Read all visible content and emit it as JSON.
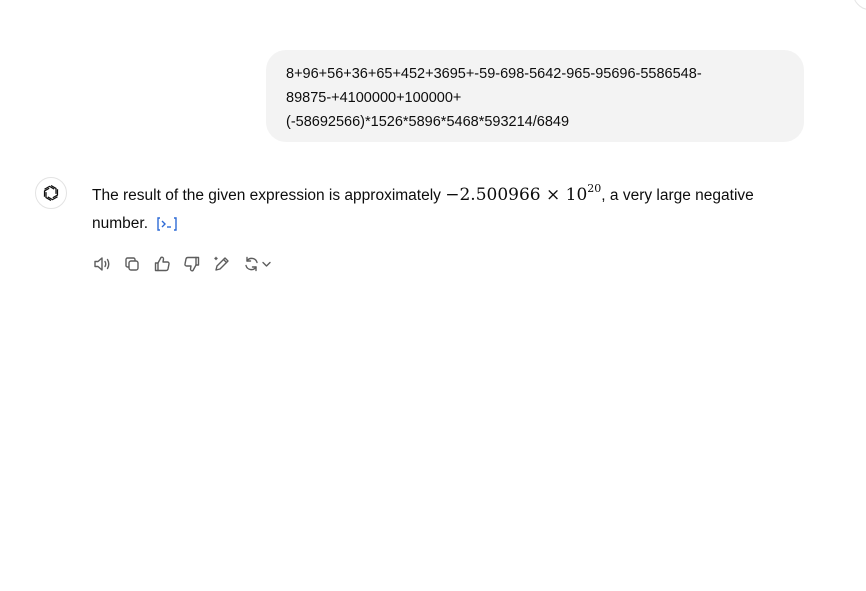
{
  "user_message": {
    "lines": [
      "8+96+56+36+65+452+3695+-59-698-5642-965-95696-5586548-",
      "89875-+4100000+100000+",
      "(-58692566)*1526*5896*5468*593214/6849"
    ]
  },
  "assistant_message": {
    "text_before": "The result of the given expression is approximately ",
    "math_mantissa": "−2.500966 × 10",
    "math_exponent": "20",
    "text_after": ", a very large negative number.",
    "code_link_label": "[>_]"
  },
  "actions": [
    {
      "icon": "speaker-icon"
    },
    {
      "icon": "copy-icon"
    },
    {
      "icon": "thumbs-up-icon"
    },
    {
      "icon": "thumbs-down-icon"
    },
    {
      "icon": "edit-pencil-icon"
    },
    {
      "icon": "regenerate-icon"
    }
  ],
  "colors": {
    "bubble_bg": "#f3f3f3",
    "text": "#0d0d0d",
    "icon": "#5d5d5d",
    "link": "#2f6bd6"
  }
}
